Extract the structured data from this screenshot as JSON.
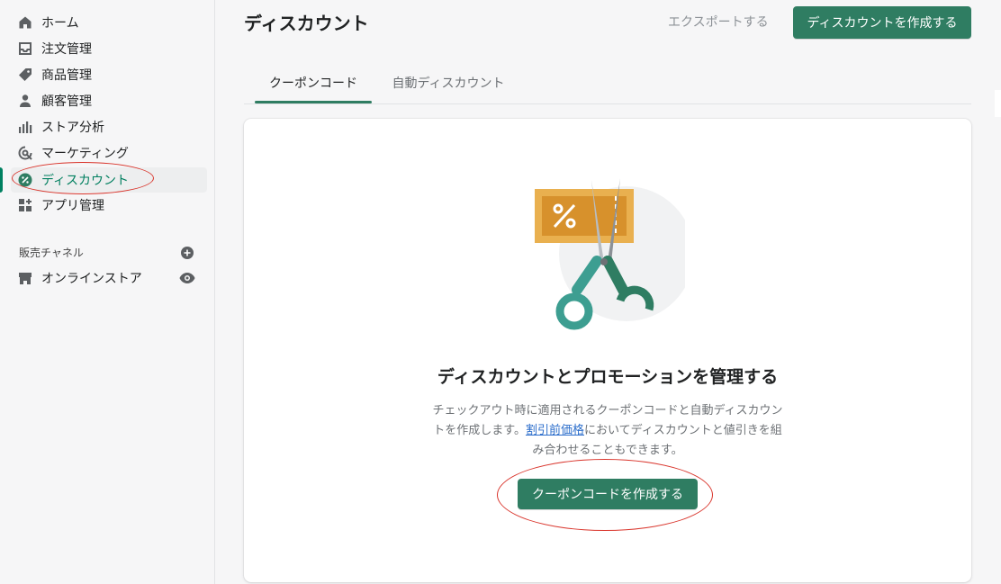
{
  "sidebar": {
    "items": [
      {
        "label": "ホーム",
        "icon": "home-icon"
      },
      {
        "label": "注文管理",
        "icon": "inbox-icon"
      },
      {
        "label": "商品管理",
        "icon": "tag-icon"
      },
      {
        "label": "顧客管理",
        "icon": "person-icon"
      },
      {
        "label": "ストア分析",
        "icon": "bar-chart-icon"
      },
      {
        "label": "マーケティング",
        "icon": "target-icon"
      },
      {
        "label": "ディスカウント",
        "icon": "discount-icon"
      },
      {
        "label": "アプリ管理",
        "icon": "apps-icon"
      }
    ],
    "active_index": 6,
    "channels_label": "販売チャネル",
    "channels": [
      {
        "label": "オンラインストア",
        "icon": "store-icon"
      }
    ]
  },
  "header": {
    "title": "ディスカウント",
    "export_label": "エクスポートする",
    "create_label": "ディスカウントを作成する"
  },
  "tabs": [
    {
      "label": "クーポンコード"
    },
    {
      "label": "自動ディスカウント"
    }
  ],
  "empty_state": {
    "heading": "ディスカウントとプロモーションを管理する",
    "body_before": "チェックアウト時に適用されるクーポンコードと自動ディスカウントを作成します。",
    "link": "割引前価格",
    "body_after": "においてディスカウントと値引きを組み合わせることもできます。",
    "cta_label": "クーポンコードを作成する"
  },
  "colors": {
    "accent": "#2f7d62",
    "active_text": "#007f5f",
    "annotation": "#d9342b"
  }
}
